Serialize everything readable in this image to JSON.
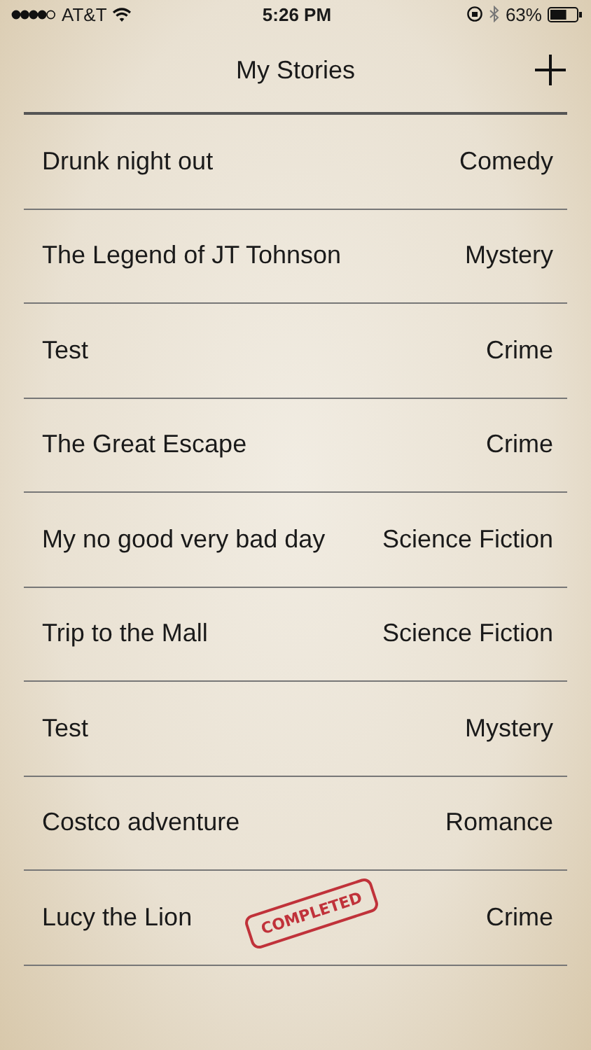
{
  "status_bar": {
    "carrier": "AT&T",
    "time": "5:26 PM",
    "battery": "63%"
  },
  "nav": {
    "title": "My Stories"
  },
  "stories": [
    {
      "title": "Drunk night out",
      "genre": "Comedy",
      "completed": false
    },
    {
      "title": "The Legend of JT Tohnson",
      "genre": "Mystery",
      "completed": false
    },
    {
      "title": "Test",
      "genre": "Crime",
      "completed": false
    },
    {
      "title": "The Great Escape",
      "genre": "Crime",
      "completed": false
    },
    {
      "title": "My no good very bad day",
      "genre": "Science Fiction",
      "completed": false
    },
    {
      "title": "Trip to the Mall",
      "genre": "Science Fiction",
      "completed": false
    },
    {
      "title": "Test",
      "genre": "Mystery",
      "completed": false
    },
    {
      "title": "Costco adventure",
      "genre": "Romance",
      "completed": false
    },
    {
      "title": "Lucy the Lion",
      "genre": "Crime",
      "completed": true,
      "stamp": "COMPLETED"
    }
  ]
}
